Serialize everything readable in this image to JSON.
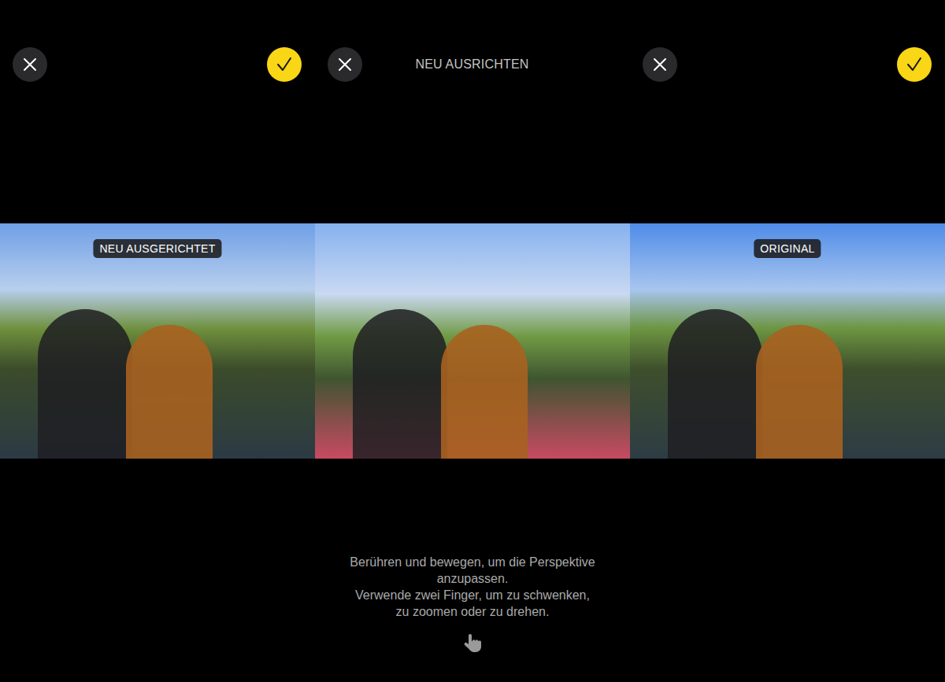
{
  "panels": [
    {
      "kind": "result",
      "badge": "NEU AUSGERICHTET",
      "confirm": true
    },
    {
      "kind": "editor",
      "title": "NEU AUSRICHTEN",
      "confirm": false,
      "instructions": [
        "Berühren und bewegen, um die Perspektive",
        "anzupassen.",
        "Verwende zwei Finger, um zu schwenken,",
        "zu zoomen oder zu drehen."
      ]
    },
    {
      "kind": "original",
      "badge": "ORIGINAL",
      "confirm": true
    }
  ]
}
